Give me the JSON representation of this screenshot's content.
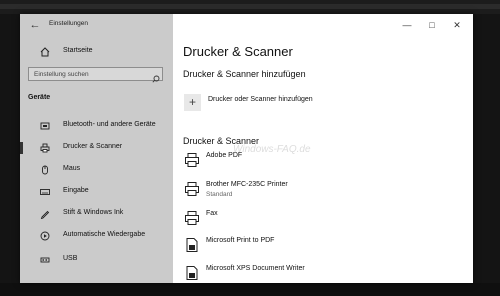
{
  "window": {
    "title": "Einstellungen"
  },
  "sidebar": {
    "home_label": "Startseite",
    "search_placeholder": "Einstellung suchen",
    "section": "Geräte",
    "items": [
      {
        "label": "Bluetooth- und andere Geräte",
        "icon": "bluetooth-icon"
      },
      {
        "label": "Drucker & Scanner",
        "icon": "printer-icon",
        "selected": true
      },
      {
        "label": "Maus",
        "icon": "mouse-icon"
      },
      {
        "label": "Eingabe",
        "icon": "keyboard-icon"
      },
      {
        "label": "Stift & Windows Ink",
        "icon": "pen-icon"
      },
      {
        "label": "Automatische Wiedergabe",
        "icon": "autoplay-icon"
      },
      {
        "label": "USB",
        "icon": "usb-icon"
      }
    ]
  },
  "main": {
    "title": "Drucker & Scanner",
    "add_heading": "Drucker & Scanner hinzufügen",
    "add_label": "Drucker oder Scanner hinzufügen",
    "list_heading": "Drucker & Scanner",
    "watermark": "Windows-FAQ.de",
    "printers": [
      {
        "name": "Adobe PDF",
        "status": ""
      },
      {
        "name": "Brother MFC-235C Printer",
        "status": "Standard"
      },
      {
        "name": "Fax",
        "status": ""
      },
      {
        "name": "Microsoft Print to PDF",
        "status": ""
      },
      {
        "name": "Microsoft XPS Document Writer",
        "status": ""
      }
    ]
  },
  "colors": {
    "sidebar_bg": "#cbcbcb",
    "content_bg": "#ffffff",
    "selection": "#333333"
  }
}
